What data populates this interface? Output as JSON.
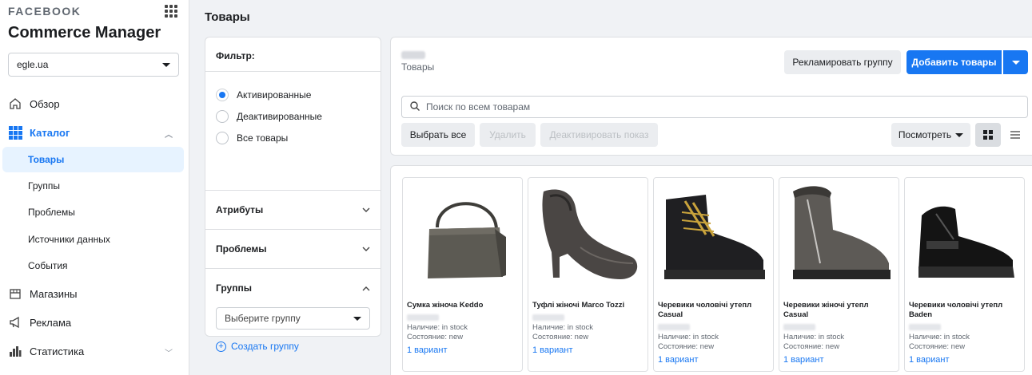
{
  "sidebar": {
    "brand": "FACEBOOK",
    "app_title": "Commerce Manager",
    "account": "egle.ua",
    "nav": {
      "overview": "Обзор",
      "catalog": "Каталог",
      "catalog_sub": [
        "Товары",
        "Группы",
        "Проблемы",
        "Источники данных",
        "События"
      ],
      "shops": "Магазины",
      "ads": "Реклама",
      "stats": "Статистика"
    }
  },
  "header": {
    "title": "Товары"
  },
  "filter": {
    "title": "Фильтр:",
    "options": [
      "Активированные",
      "Деактивированные",
      "Все товары"
    ],
    "selected_index": 0,
    "attributes": "Атрибуты",
    "problems": "Проблемы",
    "groups": "Группы",
    "group_placeholder": "Выберите группу",
    "create_group": "Создать группу"
  },
  "toolbar": {
    "catalog_label": "Товары",
    "promote_group": "Рекламировать группу",
    "add_products": "Добавить товары",
    "search_placeholder": "Поиск по всем товарам",
    "select_all": "Выбрать все",
    "delete": "Удалить",
    "deactivate": "Деактивировать показ",
    "view": "Посмотреть"
  },
  "products": [
    {
      "name": "Сумка жіноча Keddo",
      "availability": "Наличие: in stock",
      "condition": "Состояние: new",
      "variants": "1 вариант",
      "image": "bag-image"
    },
    {
      "name": "Туфлі жіночі Marco Tozzi",
      "availability": "Наличие: in stock",
      "condition": "Состояние: new",
      "variants": "1 вариант",
      "image": "heel-image"
    },
    {
      "name": "Черевики чоловічі утепл Casual",
      "availability": "Наличие: in stock",
      "condition": "Состояние: new",
      "variants": "1 вариант",
      "image": "boot-image"
    },
    {
      "name": "Черевики жіночі утепл Casual",
      "availability": "Наличие: in stock",
      "condition": "Состояние: new",
      "variants": "1 вариант",
      "image": "winter-boot-image"
    },
    {
      "name": "Черевики чоловічі утепл Baden",
      "availability": "Наличие: in stock",
      "condition": "Состояние: new",
      "variants": "1 вариант",
      "image": "sneaker-boot-image"
    }
  ],
  "colors": {
    "accent": "#1877f2",
    "active_bg": "#e7f3ff",
    "background": "#f0f2f5"
  }
}
